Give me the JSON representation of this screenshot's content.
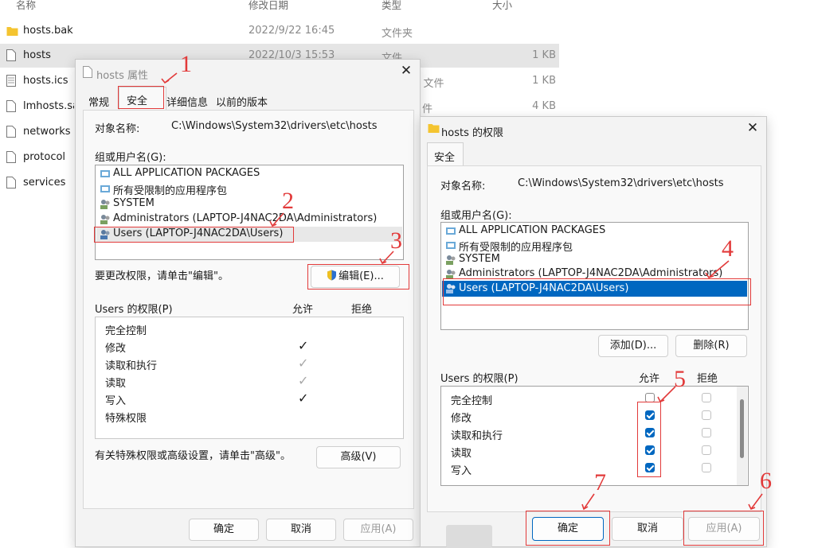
{
  "explorer": {
    "columns": {
      "name": "名称",
      "date": "修改日期",
      "type": "类型",
      "size": "大小"
    },
    "files": [
      {
        "name": "hosts.bak",
        "date": "2022/9/22 16:45",
        "type": "文件夹",
        "size": "",
        "icon": "folder-icon"
      },
      {
        "name": "hosts",
        "date": "2022/10/3 15:53",
        "type": "文件",
        "size": "1 KB",
        "icon": "file-icon"
      },
      {
        "name": "hosts.ics",
        "date": "",
        "type": "r 文件",
        "size": "1 KB",
        "icon": "file-icon"
      },
      {
        "name": "lmhosts.sam",
        "date": "",
        "type": "件",
        "size": "4 KB",
        "icon": "file-icon"
      },
      {
        "name": "networks",
        "date": "",
        "type": "",
        "size": "",
        "icon": "file-icon"
      },
      {
        "name": "protocol",
        "date": "",
        "type": "",
        "size": "",
        "icon": "file-icon"
      },
      {
        "name": "services",
        "date": "",
        "type": "",
        "size": "",
        "icon": "file-icon"
      }
    ]
  },
  "props": {
    "title": "hosts 属性",
    "tabs": [
      "常规",
      "安全",
      "详细信息",
      "以前的版本"
    ],
    "object_label": "对象名称:",
    "object_path": "C:\\Windows\\System32\\drivers\\etc\\hosts",
    "group_label": "组或用户名(G):",
    "users": [
      "ALL APPLICATION PACKAGES",
      "所有受限制的应用程序包",
      "SYSTEM",
      "Administrators (LAPTOP-J4NAC2DA\\Administrators)",
      "Users (LAPTOP-J4NAC2DA\\Users)"
    ],
    "change_hint": "要更改权限，请单击\"编辑\"。",
    "edit_button": "编辑(E)...",
    "perm_label": "Users 的权限(P)",
    "allow": "允许",
    "deny": "拒绝",
    "perms": [
      "完全控制",
      "修改",
      "读取和执行",
      "读取",
      "写入",
      "特殊权限"
    ],
    "advanced_hint": "有关特殊权限或高级设置，请单击\"高级\"。",
    "advanced_button": "高级(V)",
    "ok": "确定",
    "cancel": "取消",
    "apply": "应用(A)"
  },
  "perm_dialog": {
    "title": "hosts 的权限",
    "tab": "安全",
    "object_label": "对象名称:",
    "object_path": "C:\\Windows\\System32\\drivers\\etc\\hosts",
    "group_label": "组或用户名(G):",
    "users": [
      "ALL APPLICATION PACKAGES",
      "所有受限制的应用程序包",
      "SYSTEM",
      "Administrators (LAPTOP-J4NAC2DA\\Administrators)",
      "Users (LAPTOP-J4NAC2DA\\Users)"
    ],
    "add_button": "添加(D)...",
    "remove_button": "删除(R)",
    "perm_label": "Users 的权限(P)",
    "allow": "允许",
    "deny": "拒绝",
    "perms": [
      "完全控制",
      "修改",
      "读取和执行",
      "读取",
      "写入"
    ],
    "ok": "确定",
    "cancel": "取消",
    "apply": "应用(A)"
  },
  "annotations": [
    "1",
    "2",
    "3",
    "4",
    "5",
    "6",
    "7"
  ],
  "colors": {
    "annotation": "#e23a3a",
    "selection": "#0067c0"
  }
}
